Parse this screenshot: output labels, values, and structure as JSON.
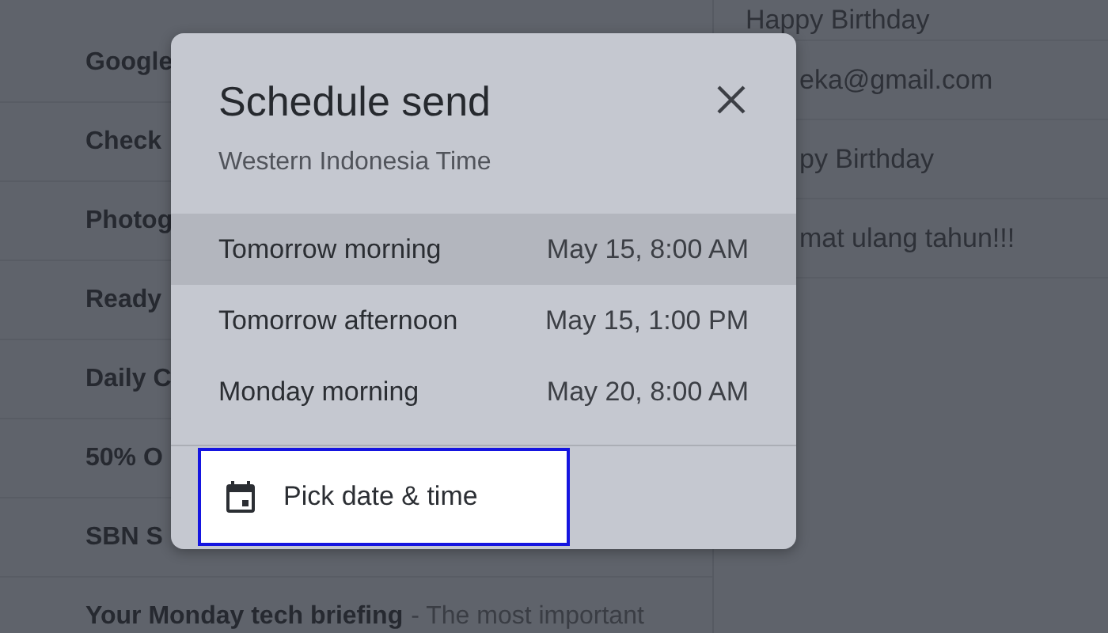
{
  "email_list": [
    {
      "subject": "Google"
    },
    {
      "subject": "Check"
    },
    {
      "subject": "Photog"
    },
    {
      "subject": "Ready"
    },
    {
      "subject": "Daily C"
    },
    {
      "subject": "50% O"
    },
    {
      "subject": "SBN S"
    },
    {
      "subject": "Your Monday tech briefing",
      "snippet": "- The most important"
    }
  ],
  "message_panel": [
    "Happy Birthday",
    "eka@gmail.com",
    "py Birthday",
    "mat ulang tahun!!!"
  ],
  "dialog": {
    "title": "Schedule send",
    "subtitle": "Western Indonesia Time",
    "options": [
      {
        "label": "Tomorrow morning",
        "time": "May 15, 8:00 AM",
        "selected": true
      },
      {
        "label": "Tomorrow afternoon",
        "time": "May 15, 1:00 PM",
        "selected": false
      },
      {
        "label": "Monday morning",
        "time": "May 20, 8:00 AM",
        "selected": false
      }
    ],
    "pick": {
      "label": "Pick date & time",
      "highlighted": true
    }
  }
}
